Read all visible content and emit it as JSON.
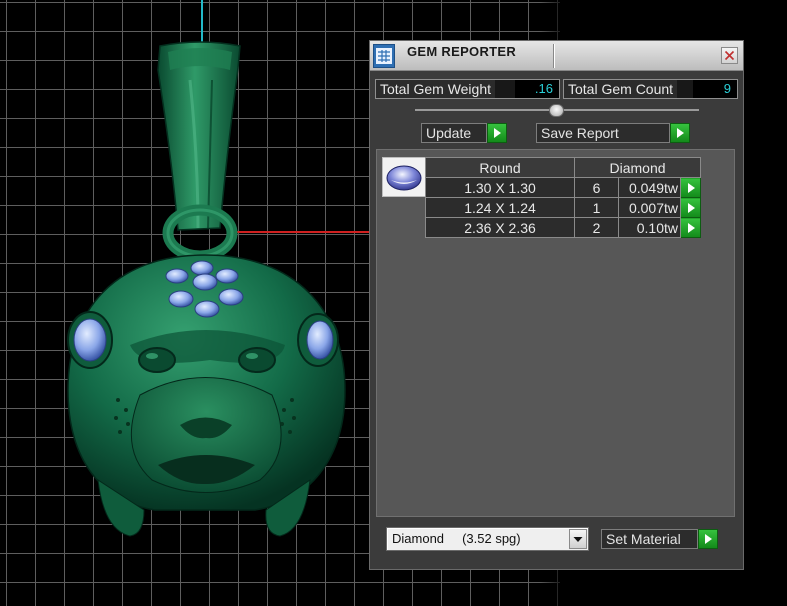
{
  "window": {
    "title": "GEM REPORTER"
  },
  "summary": {
    "total_weight_label": "Total Gem Weight",
    "total_weight_value": ".16",
    "total_count_label": "Total Gem Count",
    "total_count_value": "9"
  },
  "actions": {
    "update_label": "Update",
    "save_report_label": "Save Report",
    "set_material_label": "Set Material"
  },
  "gem_table": {
    "headers": [
      "Round",
      "Diamond"
    ],
    "rows": [
      {
        "size": "1.30 X 1.30",
        "count": "6",
        "weight": "0.049tw"
      },
      {
        "size": "1.24 X 1.24",
        "count": "1",
        "weight": "0.007tw"
      },
      {
        "size": "2.36 X 2.36",
        "count": "2",
        "weight": "0.10tw"
      }
    ]
  },
  "material": {
    "selected": "Diamond     (3.52 spg)"
  },
  "icons": {
    "window_icon": "gem-reporter-icon",
    "close": "close-icon",
    "run": "play-arrow-icon",
    "dropdown": "chevron-down-icon",
    "gem_shape": "round-gem-icon"
  },
  "colors": {
    "accent_cyan": "#2ad0d8",
    "arrow_green": "#1fa827",
    "model_green": "#0f6a45",
    "gem_blue": "#8aa6e8",
    "panel_bg": "#3b3b3b"
  }
}
